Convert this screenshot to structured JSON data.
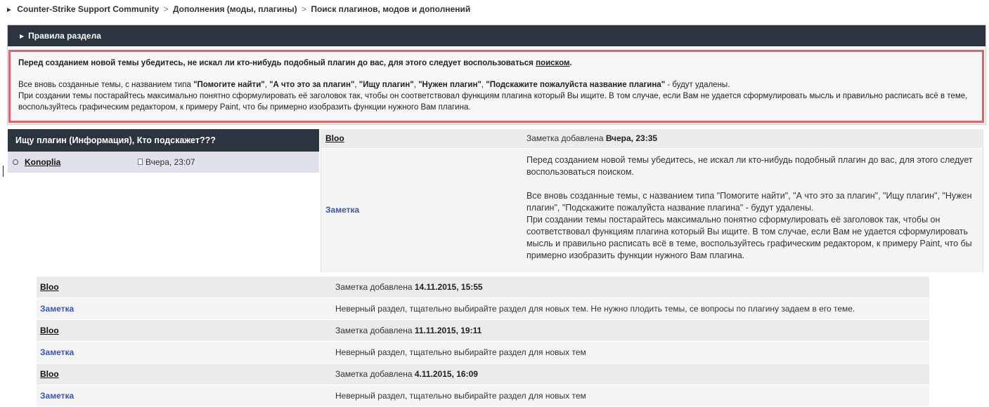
{
  "breadcrumb": {
    "items": [
      "Counter-Strike Support Community",
      "Дополнения (моды, плагины)",
      "Поиск плагинов, модов и дополнений"
    ],
    "separator": ">"
  },
  "rules": {
    "header": "Правила раздела",
    "line1_text": "Перед созданием новой темы убедитесь, не искал ли кто-нибудь подобный плагин до вас, для этого следует воспользоваться ",
    "line1_link": "поиском",
    "line1_end": ".",
    "line2_prefix": "Все вновь созданные темы, с названием типа ",
    "line2_t1": "\"Помогите найти\"",
    "line2_t2": "\"А что это за плагин\"",
    "line2_t3": "\"Ищу плагин\"",
    "line2_t4": "\"Нужен плагин\"",
    "line2_t5": "\"Подскажите пожалуйста название плагина\"",
    "line2_suffix": " - будут удалены.",
    "line3": "При создании темы постарайтесь максимально понятно сформулировать её заголовок так, чтобы он соответствовал функциям плагина который Вы ищите. В том случае, если Вам не удается сформулировать мысль и правильно расписать всё в теме, воспользуйтесь графическим редактором, к примеру Paint, что бы примерно изобразить функции нужного Вам плагина."
  },
  "thread": {
    "title": "Ищу плагин (Информация), Кто подскажет???",
    "author": "Konoplia",
    "time": "Вчера, 23:07"
  },
  "note_main": {
    "author": "Bloo",
    "meta_prefix": "Заметка добавлена ",
    "meta_time": "Вчера, 23:35",
    "label": "Заметка",
    "para1": "Перед созданием новой темы убедитесь, не искал ли кто-нибудь подобный плагин до вас, для этого следует воспользоваться поиском.",
    "para2": "Все вновь созданные темы, с названием типа \"Помогите найти\", \"А что это за плагин\", \"Ищу плагин\", \"Нужен плагин\", \"Подскажите пожалуйста название плагина\" - будут удалены.",
    "para3": "При создании темы постарайтесь максимально понятно сформулировать её заголовок так, чтобы он соответствовал функциям плагина который Вы ищите. В том случае, если Вам не удается сформулировать мысль и правильно расписать всё в теме, воспользуйтесь графическим редактором, к примеру Paint, что бы примерно изобразить функции нужного Вам плагина."
  },
  "notes": [
    {
      "author": "Bloo",
      "meta_prefix": "Заметка добавлена ",
      "meta_time": "14.11.2015, 15:55",
      "label": "Заметка",
      "text": "Неверный раздел, тщательно выбирайте раздел для новых тем. Не нужно плодить темы, се вопросы по плагину задаем в его теме."
    },
    {
      "author": "Bloo",
      "meta_prefix": "Заметка добавлена ",
      "meta_time": "11.11.2015, 19:11",
      "label": "Заметка",
      "text": "Неверный раздел, тщательно выбирайте раздел для новых тем"
    },
    {
      "author": "Bloo",
      "meta_prefix": "Заметка добавлена ",
      "meta_time": "4.11.2015, 16:09",
      "label": "Заметка",
      "text": "Неверный раздел, тщательно выбирайте раздел для новых тем"
    }
  ]
}
